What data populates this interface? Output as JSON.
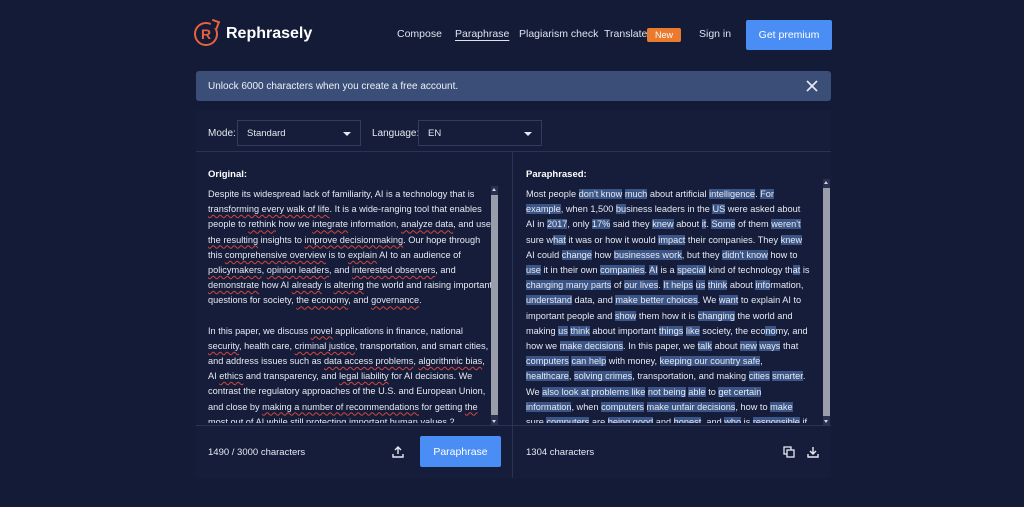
{
  "header": {
    "logo_letter": "R",
    "brand": "Rephrasely",
    "nav": {
      "compose": "Compose",
      "paraphrase": "Paraphrase",
      "plagiarism": "Plagiarism check",
      "translate": "Translate",
      "new_badge": "New",
      "signin": "Sign in"
    },
    "premium_button": "Get premium"
  },
  "banner": {
    "text": "Unlock 6000 characters when you create a free account."
  },
  "controls": {
    "mode_label": "Mode:",
    "mode_value": "Standard",
    "language_label": "Language:",
    "language_value": "EN"
  },
  "original": {
    "title": "Original:",
    "char_count": "1490 / 3000 characters",
    "paraphrase_button": "Paraphrase"
  },
  "paraphrased": {
    "title": "Paraphrased:",
    "char_count": "1304 characters"
  },
  "colors": {
    "background": "#131b37",
    "accent": "#4a8ef5",
    "brand": "#e8623c",
    "badge": "#ea7a2d",
    "highlight": "#3b5586",
    "spellcheck": "#d4453c"
  },
  "icons": {
    "close": "close-icon",
    "upload": "upload-icon",
    "copy": "copy-icon",
    "download": "download-icon"
  }
}
